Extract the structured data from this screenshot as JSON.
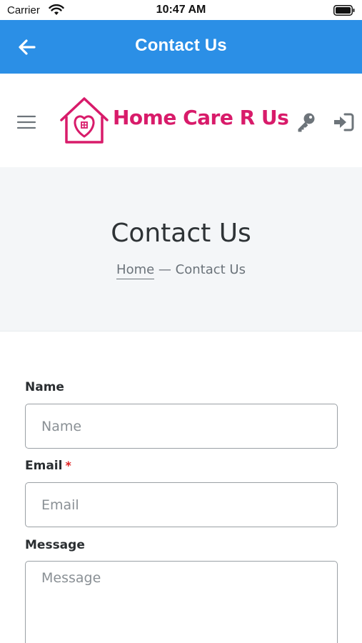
{
  "status_bar": {
    "carrier": "Carrier",
    "time": "10:47 AM",
    "icons": [
      "wifi-icon",
      "battery-icon"
    ]
  },
  "app_bar": {
    "title": "Contact Us",
    "back_icon": "arrow-left-icon",
    "color": "#2b8fe6"
  },
  "site_header": {
    "logo_text": "Home Care R Us",
    "logo_color": "#d81b6a",
    "icons": [
      "hamburger-menu-icon",
      "key-icon",
      "sign-in-icon"
    ]
  },
  "hero": {
    "title": "Contact Us",
    "breadcrumb": {
      "home": "Home",
      "separator": " — ",
      "current": "Contact Us"
    }
  },
  "form": {
    "name_label": "Name",
    "name_placeholder": "Name",
    "email_label": "Email",
    "email_required_mark": "*",
    "email_placeholder": "Email",
    "message_label": "Message",
    "message_placeholder": "Message"
  }
}
